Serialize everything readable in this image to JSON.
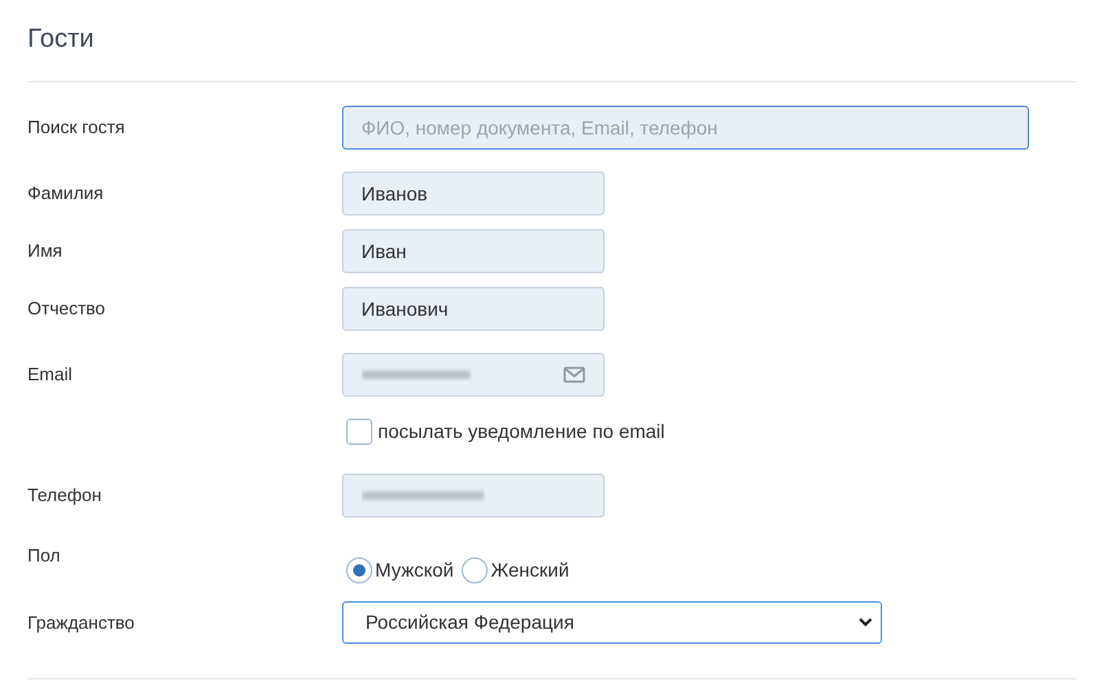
{
  "title": "Гости",
  "search": {
    "label": "Поиск гостя",
    "placeholder": "ФИО, номер документа, Email, телефон"
  },
  "surname": {
    "label": "Фамилия",
    "value": "Иванов"
  },
  "name": {
    "label": "Имя",
    "value": "Иван"
  },
  "patronymic": {
    "label": "Отчество",
    "value": "Иванович"
  },
  "email": {
    "label": "Email"
  },
  "notify": {
    "label": "посылать уведомление по email",
    "checked": false
  },
  "phone": {
    "label": "Телефон"
  },
  "gender": {
    "label": "Пол",
    "options": [
      {
        "label": "Мужской",
        "selected": true
      },
      {
        "label": "Женский",
        "selected": false
      }
    ]
  },
  "citizenship": {
    "label": "Гражданство",
    "value": "Российская Федерация"
  }
}
